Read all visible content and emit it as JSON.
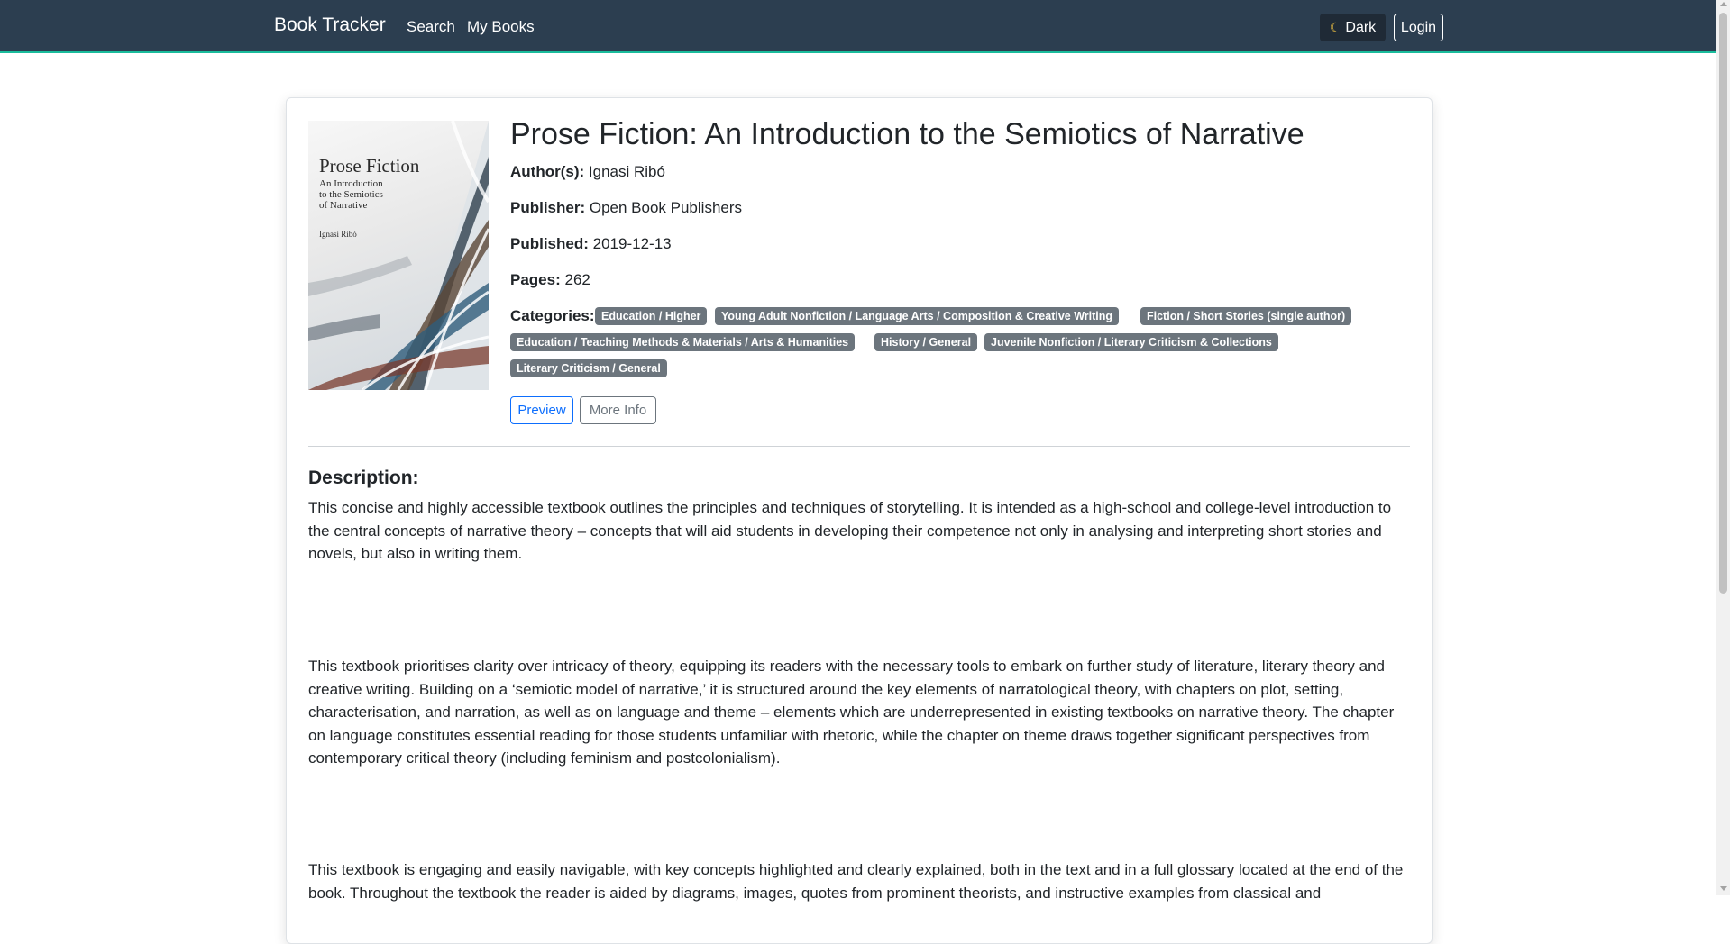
{
  "navbar": {
    "brand": "Book Tracker",
    "links": [
      "Search",
      "My Books"
    ],
    "dark_label": "Dark",
    "login_label": "Login",
    "colors": {
      "background": "#2c3e50",
      "accent_border": "#1abc9c"
    }
  },
  "book": {
    "cover": {
      "title": "Prose Fiction",
      "subtitle": "An Introduction to the Semiotics of Narrative",
      "author": "Ignasi Ribó"
    },
    "title": "Prose Fiction: An Introduction to the Semiotics of Narrative",
    "authors_label": "Author(s):",
    "authors": "Ignasi Ribó",
    "publisher_label": "Publisher:",
    "publisher": "Open Book Publishers",
    "published_label": "Published:",
    "published": "2019-12-13",
    "pages_label": "Pages:",
    "pages": "262",
    "categories_label": "Categories:",
    "categories": [
      "Education / Higher",
      "Young Adult Nonfiction / Language Arts / Composition & Creative Writing",
      "Fiction / Short Stories (single author)",
      "Education / Teaching Methods & Materials / Arts & Humanities",
      "History / General",
      "Juvenile Nonfiction / Literary Criticism & Collections",
      "Literary Criticism / General"
    ],
    "preview_label": "Preview",
    "more_info_label": "More Info"
  },
  "description": {
    "heading": "Description:",
    "paragraphs": [
      "This concise and highly accessible textbook outlines the principles and techniques of storytelling. It is intended as a high-school and college-level introduction to the central concepts of narrative theory – concepts that will aid students in developing their competence not only in analysing and interpreting short stories and novels, but also in writing them.",
      "This textbook prioritises clarity over intricacy of theory, equipping its readers with the necessary tools to embark on further study of literature, literary theory and creative writing. Building on a ‘semiotic model of narrative,’ it is structured around the key elements of narratological theory, with chapters on plot, setting, characterisation, and narration, as well as on language and theme – elements which are underrepresented in existing textbooks on narrative theory. The chapter on language constitutes essential reading for those students unfamiliar with rhetoric, while the chapter on theme draws together significant perspectives from contemporary critical theory (including feminism and postcolonialism).",
      "This textbook is engaging and easily navigable, with key concepts highlighted and clearly explained, both in the text and in a full glossary located at the end of the book. Throughout the textbook the reader is aided by diagrams, images, quotes from prominent theorists, and instructive examples from classical and"
    ]
  },
  "colors": {
    "badge": "#6c757d",
    "preview": "#0d6efd",
    "more_info": "#6c757d"
  }
}
